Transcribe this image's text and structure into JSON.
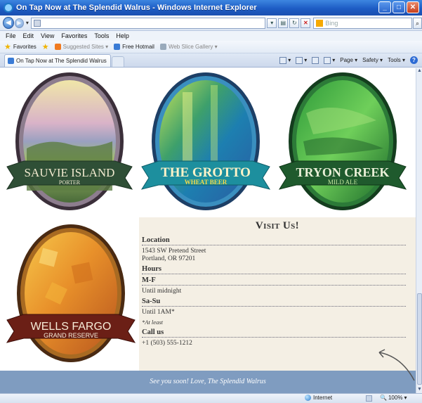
{
  "window": {
    "title": "On Tap Now at The Splendid Walrus - Windows Internet Explorer",
    "buttons": {
      "minimize": "_",
      "maximize": "□",
      "close": "✕"
    }
  },
  "address": {
    "url": "",
    "search_placeholder": "Bing"
  },
  "menu": [
    "File",
    "Edit",
    "View",
    "Favorites",
    "Tools",
    "Help"
  ],
  "favorites_bar": {
    "favorites_label": "Favorites",
    "items": [
      {
        "label": "Suggested Sites ▾",
        "dim": true
      },
      {
        "label": "Free Hotmail",
        "dim": false
      },
      {
        "label": "Web Slice Gallery ▾",
        "dim": true
      }
    ]
  },
  "tab": {
    "label": "On Tap Now at The Splendid Walrus"
  },
  "command_bar": {
    "page": "Page ▾",
    "safety": "Safety ▾",
    "tools": "Tools ▾",
    "help": "?"
  },
  "beers": [
    {
      "name": "SAUVIE ISLAND",
      "style": "PORTER"
    },
    {
      "name": "THE GROTTO",
      "style": "WHEAT BEER"
    },
    {
      "name": "TRYON CREEK",
      "style": "MILD ALE"
    },
    {
      "name": "WELLS FARGO",
      "style": "GRAND RESERVE"
    }
  ],
  "visit": {
    "title": "Visit Us!",
    "location_heading": "Location",
    "address_line1": "1543 SW Pretend Street",
    "address_line2": "Portland, OR 97201",
    "hours_heading": "Hours",
    "mf_heading": "M-F",
    "mf_hours": "Until midnight",
    "sasu_heading": "Sa-Su",
    "sasu_hours": "Until 1AM*",
    "sasu_note": "*At least",
    "call_heading": "Call us",
    "phone": "+1 (503) 555-1212"
  },
  "footer": {
    "text": "See you soon! Love, The Splendid Walrus"
  },
  "status": {
    "zone": "Internet",
    "zoom": "100%"
  }
}
